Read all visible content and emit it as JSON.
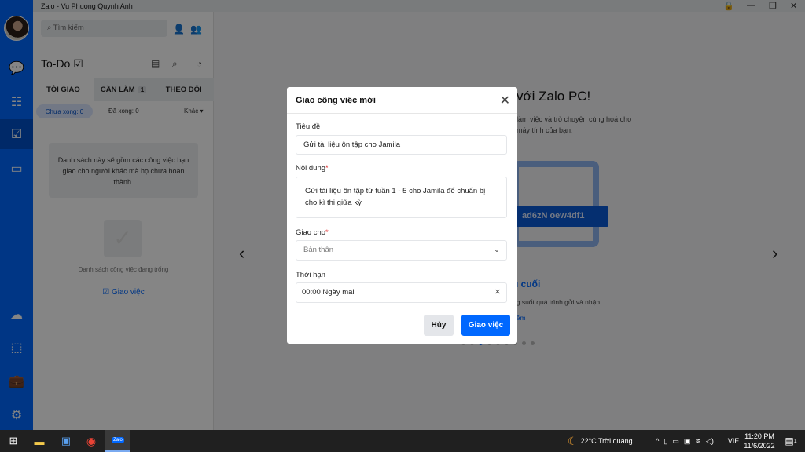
{
  "window": {
    "title": "Zalo - Vu Phuong Quynh Anh"
  },
  "nav": {
    "items": [
      "chat",
      "contacts",
      "todo",
      "video",
      "cloud",
      "screenshot",
      "toolbox",
      "settings"
    ]
  },
  "panel": {
    "search_placeholder": "Tìm kiếm",
    "title": "To-Do",
    "tabs": [
      {
        "label": "TÔI GIAO",
        "active": true
      },
      {
        "label": "CẦN LÀM",
        "badge": "1"
      },
      {
        "label": "THEO DÕI"
      }
    ],
    "filters": {
      "pending": "Chưa xong: 0",
      "done": "Đã xong: 0",
      "other": "Khác"
    },
    "info": "Danh sách này sẽ gồm các công việc bạn giao cho người khác mà họ chưa hoàn thành.",
    "empty": "Danh sách công việc đang trống",
    "assign_link": "Giao việc"
  },
  "main": {
    "welcome": "với Zalo PC!",
    "desc": "làm việc và trò chuyện cùng hoá cho máy tính của bạn.",
    "code": "ad6zN oew4df1",
    "feature_title": "u cuối",
    "feature_desc": "ng suốt quá trình gửi và nhận",
    "more": "hêm",
    "active_slide": 2,
    "slides": 9
  },
  "modal": {
    "title": "Giao công việc mới",
    "title_label": "Tiêu đề",
    "title_value": "Gửi tài liệu ôn tập cho Jamila",
    "content_label": "Nội dung",
    "content_value": "Gửi tài liệu ôn tập từ tuần 1 - 5 cho Jamila để chuẩn bị cho kì thi giữa kỳ",
    "assignee_label": "Giao cho",
    "assignee_value": "Bản thân",
    "deadline_label": "Thời hạn",
    "deadline_value": "00:00 Ngày mai",
    "cancel": "Hủy",
    "submit": "Giao việc",
    "required_mark": "*"
  },
  "taskbar": {
    "weather": "22°C  Trời quang",
    "lang": "VIE",
    "time": "11:20 PM",
    "date": "11/6/2022",
    "notifications": "1"
  },
  "colors": {
    "accent": "#0068ff",
    "sidebar": "#0068ff"
  }
}
